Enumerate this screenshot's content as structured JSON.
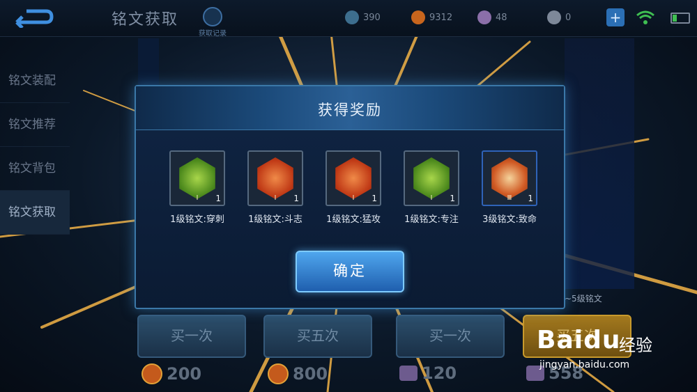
{
  "header": {
    "title": "铭文获取",
    "record_label": "获取记录",
    "resources": [
      {
        "icon": "diamond-icon",
        "value": "390",
        "color": "#3d6e8e"
      },
      {
        "icon": "coin-icon",
        "value": "9312",
        "color": "#c8651d"
      },
      {
        "icon": "crystal-icon",
        "value": "48",
        "color": "#8b6fa9"
      },
      {
        "icon": "voucher-icon",
        "value": "0",
        "color": "#7d8899"
      }
    ]
  },
  "sidebar": {
    "items": [
      {
        "label": "铭文装配",
        "active": false
      },
      {
        "label": "铭文推荐",
        "active": false
      },
      {
        "label": "铭文背包",
        "active": false
      },
      {
        "label": "铭文获取",
        "active": true
      }
    ]
  },
  "shop": {
    "level_note": "~5级铭文",
    "buttons": [
      {
        "label": "买一次",
        "price": "200",
        "currency": "coin-icon"
      },
      {
        "label": "买五次",
        "price": "800",
        "currency": "coin-icon"
      },
      {
        "label": "买一次",
        "price": "120",
        "currency": "crystal-icon"
      },
      {
        "label": "买五次",
        "price": "558",
        "currency": "crystal-icon"
      }
    ]
  },
  "dialog": {
    "title": "获得奖励",
    "confirm_label": "确定",
    "rewards": [
      {
        "name": "1级铭文:穿刺",
        "tier": "Ⅰ",
        "count": "1",
        "color": "green"
      },
      {
        "name": "1级铭文:斗志",
        "tier": "Ⅰ",
        "count": "1",
        "color": "red"
      },
      {
        "name": "1级铭文:猛攻",
        "tier": "Ⅰ",
        "count": "1",
        "color": "red"
      },
      {
        "name": "1级铭文:专注",
        "tier": "Ⅰ",
        "count": "1",
        "color": "green"
      },
      {
        "name": "3级铭文:致命",
        "tier": "Ⅲ",
        "count": "1",
        "color": "gold"
      }
    ]
  },
  "watermark": {
    "brand": "Baidu",
    "cn": "经验",
    "url": "jingyan.baidu.com"
  }
}
